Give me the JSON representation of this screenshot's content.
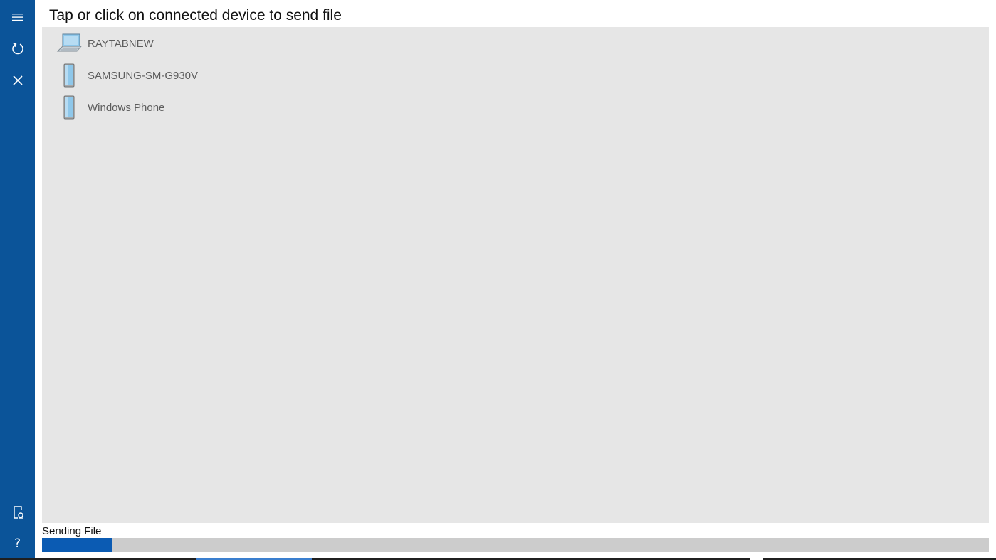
{
  "header": {
    "title": "Tap or click on connected device to send file"
  },
  "nav": {
    "top": [
      {
        "name": "menu-icon"
      },
      {
        "name": "refresh-icon"
      },
      {
        "name": "close-icon"
      }
    ],
    "bottom": [
      {
        "name": "document-settings-icon"
      },
      {
        "name": "help-icon"
      }
    ],
    "help_glyph": "?"
  },
  "devices": [
    {
      "label": "RAYTABNEW",
      "icon": "laptop-icon"
    },
    {
      "label": "SAMSUNG-SM-G930V",
      "icon": "phone-icon"
    },
    {
      "label": "Windows Phone",
      "icon": "phone-icon"
    }
  ],
  "status": {
    "label": "Sending File",
    "progress": 0.074
  },
  "colors": {
    "rail": "#0b5499",
    "pane": "#e6e6e6",
    "progress_fill": "#0b5bb3",
    "progress_track": "#cccccc"
  }
}
